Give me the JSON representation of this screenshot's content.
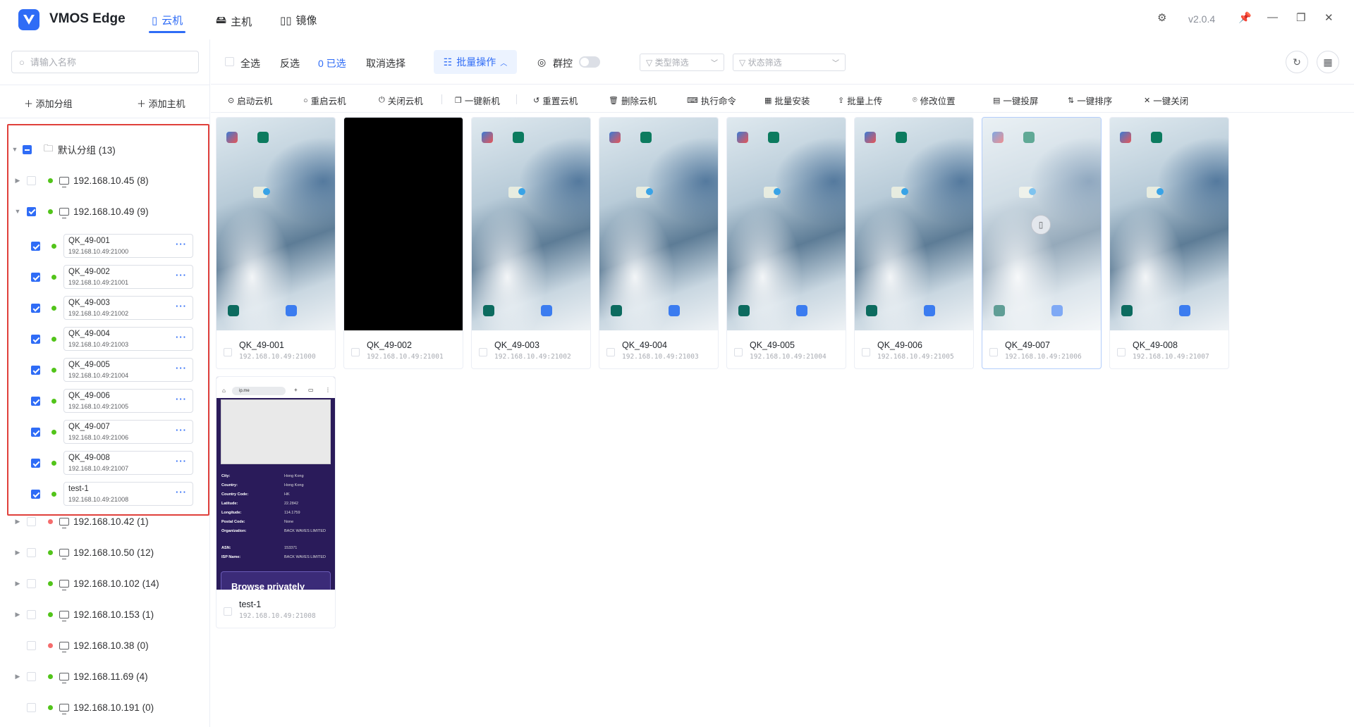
{
  "app": {
    "title": "VMOS Edge",
    "version": "v2.0.4"
  },
  "nav": [
    {
      "label": "云机",
      "icon": "cloud-phone-icon",
      "active": true
    },
    {
      "label": "主机",
      "icon": "host-icon",
      "active": false
    },
    {
      "label": "镜像",
      "icon": "image-icon",
      "active": false
    }
  ],
  "sidebar": {
    "search_placeholder": "请输入名称",
    "add_group": "添加分组",
    "add_host": "添加主机",
    "root": {
      "label": "默认分组 (13)"
    },
    "hosts": [
      {
        "label": "192.168.10.45 (8)",
        "status": "online",
        "checked": false,
        "expanded": false
      },
      {
        "label": "192.168.10.49 (9)",
        "status": "online",
        "checked": true,
        "expanded": true
      },
      {
        "label": "192.168.10.42 (1)",
        "status": "offline",
        "checked": false,
        "expanded": false
      },
      {
        "label": "192.168.10.50 (12)",
        "status": "online",
        "checked": false,
        "expanded": false
      },
      {
        "label": "192.168.10.102 (14)",
        "status": "online",
        "checked": false,
        "expanded": false
      },
      {
        "label": "192.168.10.153 (1)",
        "status": "online",
        "checked": false,
        "expanded": false
      },
      {
        "label": "192.168.10.38 (0)",
        "status": "offline",
        "checked": false,
        "expanded": false
      },
      {
        "label": "192.168.11.69 (4)",
        "status": "online",
        "checked": false,
        "expanded": false
      },
      {
        "label": "192.168.10.191 (0)",
        "status": "online",
        "checked": false,
        "expanded": false
      }
    ],
    "devices": [
      {
        "name": "QK_49-001",
        "ip": "192.168.10.49:21000"
      },
      {
        "name": "QK_49-002",
        "ip": "192.168.10.49:21001"
      },
      {
        "name": "QK_49-003",
        "ip": "192.168.10.49:21002"
      },
      {
        "name": "QK_49-004",
        "ip": "192.168.10.49:21003"
      },
      {
        "name": "QK_49-005",
        "ip": "192.168.10.49:21004"
      },
      {
        "name": "QK_49-006",
        "ip": "192.168.10.49:21005"
      },
      {
        "name": "QK_49-007",
        "ip": "192.168.10.49:21006"
      },
      {
        "name": "QK_49-008",
        "ip": "192.168.10.49:21007"
      },
      {
        "name": "test-1",
        "ip": "192.168.10.49:21008"
      }
    ],
    "more_label": "···"
  },
  "toolbar": {
    "select_all": "全选",
    "invert": "反选",
    "selected": "0 已选",
    "cancel_select": "取消选择",
    "batch": "批量操作",
    "group_control": "群控",
    "type_filter": "类型筛选",
    "status_filter": "状态筛选"
  },
  "actions": [
    "启动云机",
    "重启云机",
    "关闭云机",
    "一键新机",
    "重置云机",
    "删除云机",
    "执行命令",
    "批量安装",
    "批量上传",
    "修改位置",
    "一键投屏",
    "一键排序",
    "一键关闭"
  ],
  "cards": [
    {
      "name": "QK_49-001",
      "ip": "192.168.10.49:21000",
      "screen": "home"
    },
    {
      "name": "QK_49-002",
      "ip": "192.168.10.49:21001",
      "screen": "black"
    },
    {
      "name": "QK_49-003",
      "ip": "192.168.10.49:21002",
      "screen": "home"
    },
    {
      "name": "QK_49-004",
      "ip": "192.168.10.49:21003",
      "screen": "home"
    },
    {
      "name": "QK_49-005",
      "ip": "192.168.10.49:21004",
      "screen": "home"
    },
    {
      "name": "QK_49-006",
      "ip": "192.168.10.49:21005",
      "screen": "home"
    },
    {
      "name": "QK_49-007",
      "ip": "192.168.10.49:21006",
      "screen": "home-hover"
    },
    {
      "name": "QK_49-008",
      "ip": "192.168.10.49:21007",
      "screen": "home"
    },
    {
      "name": "test-1",
      "ip": "192.168.10.49:21008",
      "screen": "browser"
    }
  ],
  "browser": {
    "url": "ip.me",
    "rows": [
      {
        "k": "City:",
        "v": "Hong Kong"
      },
      {
        "k": "Country:",
        "v": "Hong Kong"
      },
      {
        "k": "Country Code:",
        "v": "HK"
      },
      {
        "k": "Latitude:",
        "v": "22.2842"
      },
      {
        "k": "Longitude:",
        "v": "114.1759"
      },
      {
        "k": "Postal Code:",
        "v": "None"
      },
      {
        "k": "Organization:",
        "v": "BACK WAVES LIMITED"
      },
      {
        "k": "ASN:",
        "v": "153371"
      },
      {
        "k": "ISP Name:",
        "v": "BACK WAVES LIMITED"
      }
    ],
    "cta": "Browse privately"
  }
}
